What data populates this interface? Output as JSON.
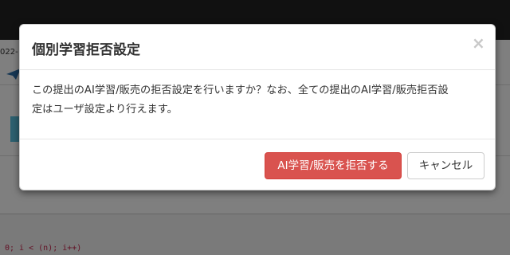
{
  "background_page": {
    "date_fragment": "022-",
    "code_fragment": "0; i < (n); i++)"
  },
  "modal": {
    "title": "個別学習拒否設定",
    "close_symbol": "×",
    "body_line1": "この提出のAI学習/販売の拒否設定を行いますか？なお、全ての提出のAI学習/販売拒否設",
    "body_line2": "定はユーザ設定より行えます。",
    "confirm_button": "AI学習/販売を拒否する",
    "cancel_button": "キャンセル"
  },
  "colors": {
    "danger": "#d9534f",
    "backdrop": "rgba(0,0,0,0.5)",
    "topbar": "#222222"
  }
}
